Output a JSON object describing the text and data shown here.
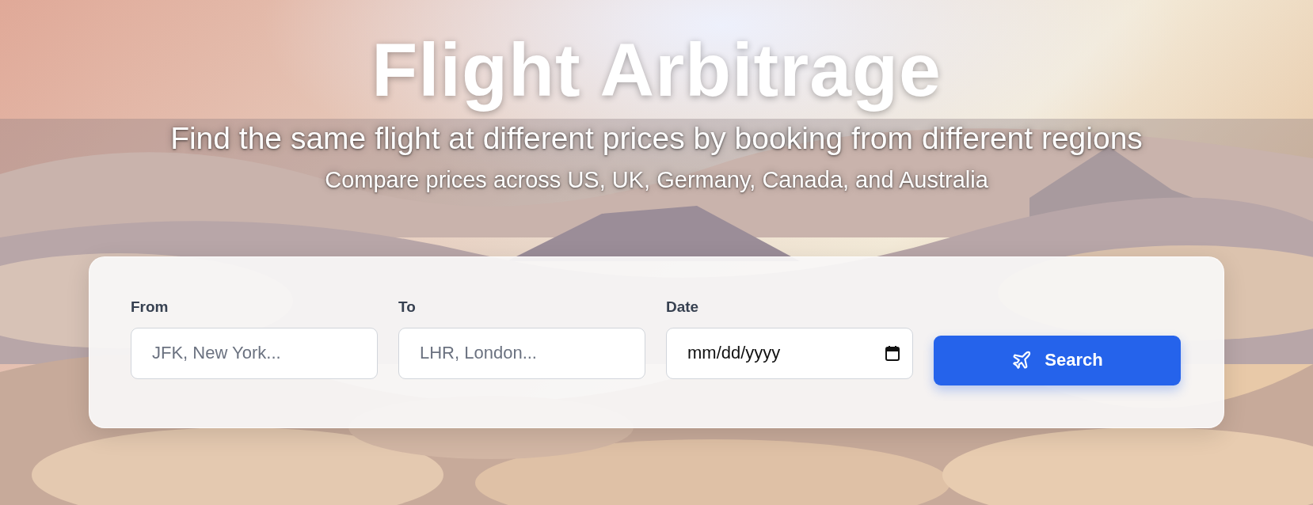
{
  "hero": {
    "title": "Flight Arbitrage",
    "subtitle": "Find the same flight at different prices by booking from different regions",
    "note": "Compare prices across US, UK, Germany, Canada, and Australia"
  },
  "search_form": {
    "fields": [
      {
        "kind": "text",
        "label": "From",
        "placeholder": "JFK, New York..."
      },
      {
        "kind": "text",
        "label": "To",
        "placeholder": "LHR, London..."
      },
      {
        "kind": "date",
        "label": "Date",
        "placeholder": "mm/dd/yyyy"
      }
    ],
    "button": {
      "label": "Search"
    }
  }
}
